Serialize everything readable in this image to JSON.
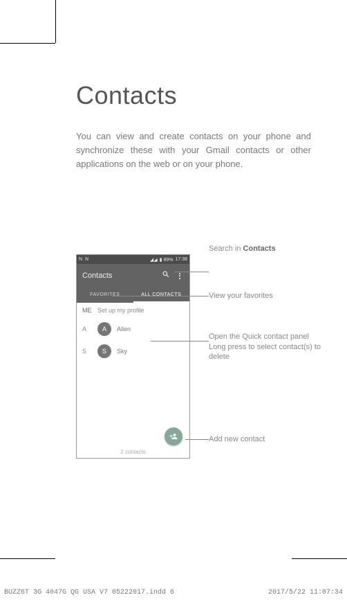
{
  "doc": {
    "title": "Contacts",
    "intro": "You can view and create contacts on your phone and synchronize these with your Gmail contacts or other applications on the web or on your phone."
  },
  "callouts": {
    "search_pre": "Search in ",
    "search_bold": "Contacts",
    "favorites": "View your favorites",
    "open_panel": "Open the Quick contact panel",
    "long_press": "Long press to select contact(s) to delete",
    "add_new": "Add new contact"
  },
  "phone": {
    "status": {
      "left": "N  N",
      "signal": "◢◢",
      "batt": "▮ 89%",
      "time": "17:38"
    },
    "app_title": "Contacts",
    "tabs": {
      "fav": "FAVORITES",
      "all": "ALL CONTACTS"
    },
    "rows": {
      "me_label": "ME",
      "me_text": "Set up my profile",
      "a_letter": "A",
      "a_avatar": "A",
      "a_name": "Allen",
      "s_letter": "S",
      "s_avatar": "S",
      "s_name": "Sky"
    },
    "count": "2 contacts"
  },
  "footer": {
    "left": "BUZZ6T 3G 4047G QG USA V7 05222017.indd   6",
    "right": "2017/5/22   11:07:34"
  }
}
